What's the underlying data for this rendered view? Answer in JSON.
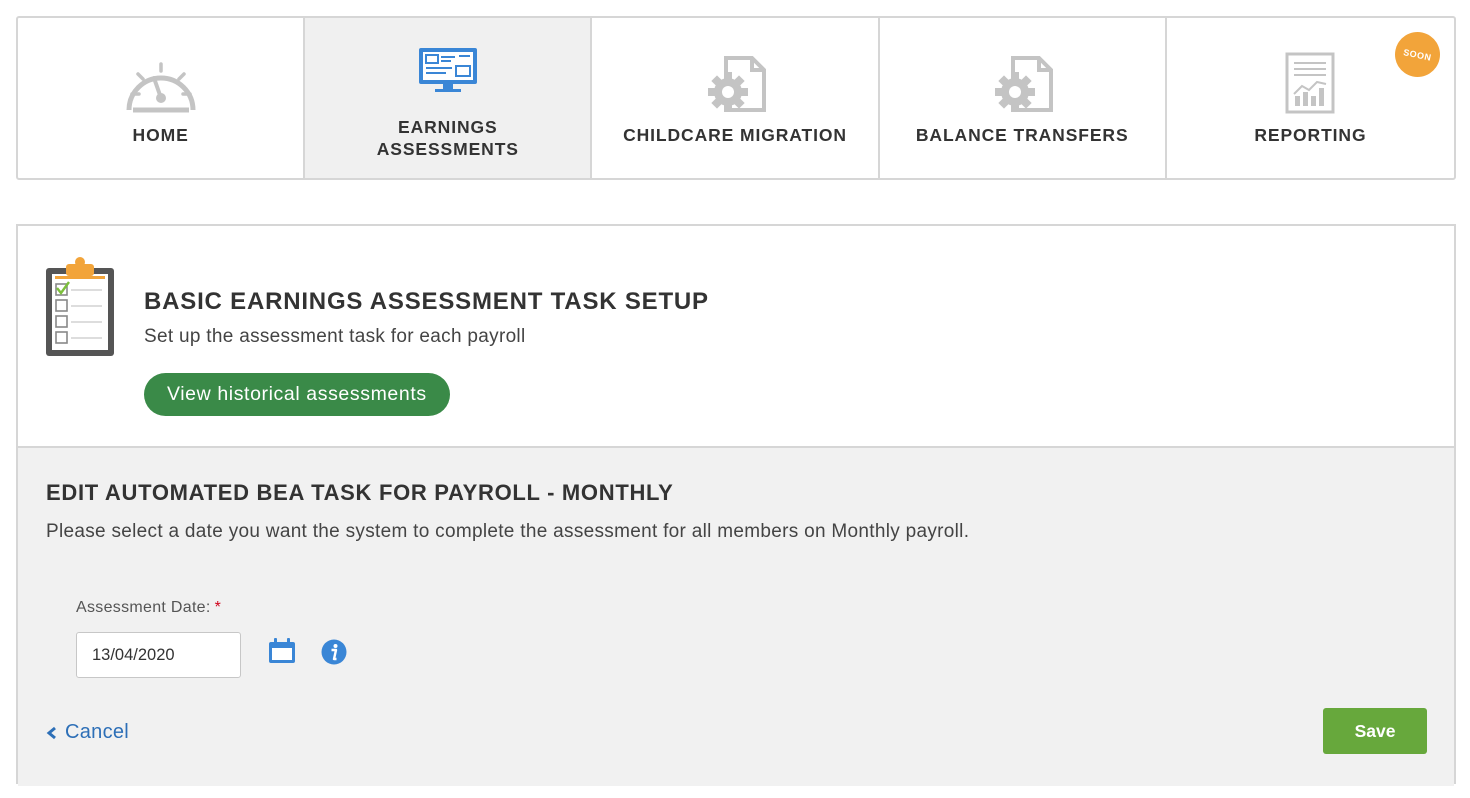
{
  "nav": {
    "tiles": [
      {
        "label": "HOME",
        "icon": "speedometer-icon"
      },
      {
        "label": "EARNINGS\nASSESSMENTS",
        "icon": "monitor-icon"
      },
      {
        "label": "CHILDCARE MIGRATION",
        "icon": "gear-document-icon"
      },
      {
        "label": "BALANCE TRANSFERS",
        "icon": "gear-document-icon"
      },
      {
        "label": "REPORTING",
        "icon": "report-chart-icon"
      }
    ],
    "active_index": 1,
    "soon_badge": "SOON"
  },
  "setup": {
    "title": "BASIC EARNINGS ASSESSMENT TASK SETUP",
    "subtitle": "Set up the assessment task for each payroll",
    "history_button": "View historical assessments"
  },
  "edit": {
    "title": "EDIT AUTOMATED BEA TASK FOR PAYROLL - MONTHLY",
    "description": "Please select a date you want the system to complete the assessment for all members on Monthly payroll.",
    "date_label": "Assessment Date:",
    "required_marker": "*",
    "date_value": "13/04/2020",
    "cancel_label": "Cancel",
    "save_label": "Save"
  },
  "colors": {
    "primary_green": "#3a8a48",
    "save_green": "#67a83c",
    "link_blue": "#2d6fb7",
    "icon_blue": "#3a86d6",
    "soon_orange": "#f2a43a",
    "required_red": "#d0021b"
  }
}
